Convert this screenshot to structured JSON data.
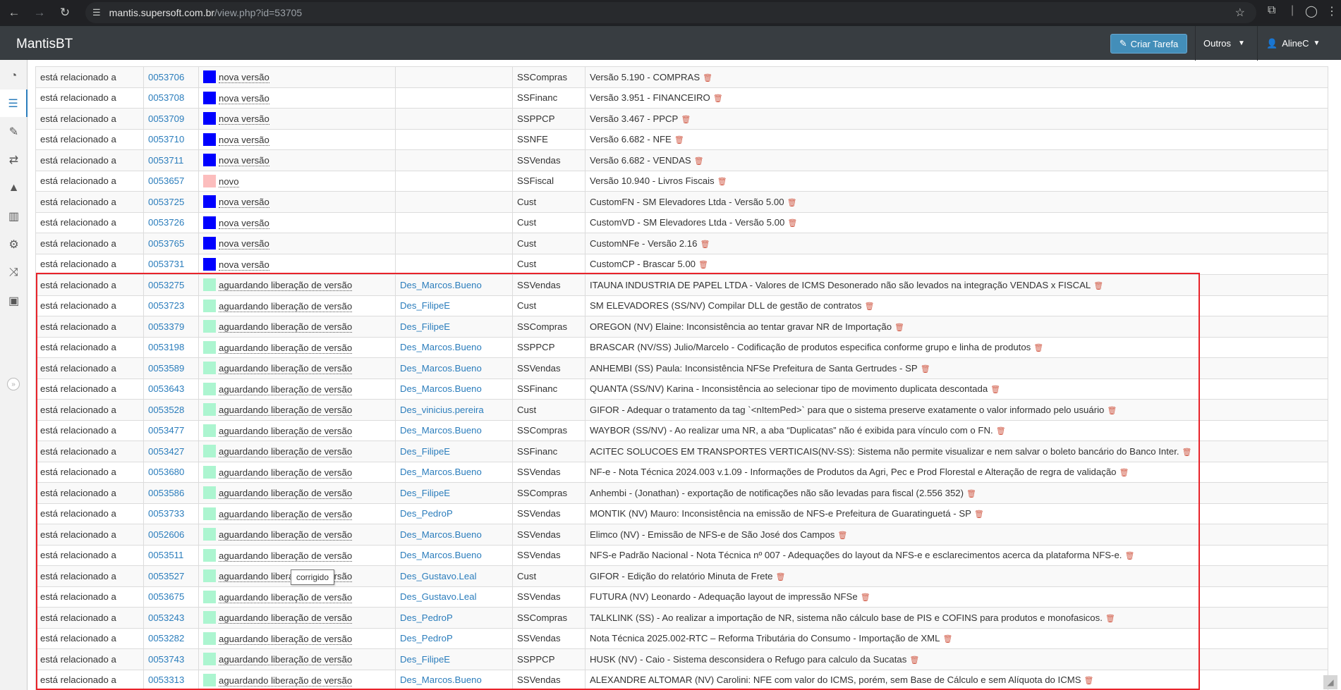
{
  "browser": {
    "url_host": "mantis.supersoft.com.br",
    "url_path": "/view.php?id=53705"
  },
  "app": {
    "brand": "MantisBT",
    "create_button": "Criar Tarefa",
    "others_menu": "Outros",
    "user": "AlineC"
  },
  "tooltip": "corrigido",
  "colors": {
    "nova_versao": "#0000ff",
    "novo": "#fcbdbd",
    "aguardando": "#acf5d0",
    "highlight": "#e8232a",
    "link": "#2b7dbc"
  },
  "rows": [
    {
      "rel": "está relacionado a",
      "id": "0053706",
      "status": "nova versão",
      "color": "#0000ff",
      "handler": "",
      "project": "SSCompras",
      "summary": "Versão 5.190 - COMPRAS"
    },
    {
      "rel": "está relacionado a",
      "id": "0053708",
      "status": "nova versão",
      "color": "#0000ff",
      "handler": "",
      "project": "SSFinanc",
      "summary": "Versão 3.951 - FINANCEIRO"
    },
    {
      "rel": "está relacionado a",
      "id": "0053709",
      "status": "nova versão",
      "color": "#0000ff",
      "handler": "",
      "project": "SSPPCP",
      "summary": "Versão 3.467 - PPCP"
    },
    {
      "rel": "está relacionado a",
      "id": "0053710",
      "status": "nova versão",
      "color": "#0000ff",
      "handler": "",
      "project": "SSNFE",
      "summary": "Versão 6.682 - NFE"
    },
    {
      "rel": "está relacionado a",
      "id": "0053711",
      "status": "nova versão",
      "color": "#0000ff",
      "handler": "",
      "project": "SSVendas",
      "summary": "Versão 6.682 - VENDAS"
    },
    {
      "rel": "está relacionado a",
      "id": "0053657",
      "status": "novo",
      "color": "#fcbdbd",
      "handler": "",
      "project": "SSFiscal",
      "summary": "Versão 10.940 - Livros Fiscais"
    },
    {
      "rel": "está relacionado a",
      "id": "0053725",
      "status": "nova versão",
      "color": "#0000ff",
      "handler": "",
      "project": "Cust",
      "summary": "CustomFN - SM Elevadores Ltda - Versão 5.00"
    },
    {
      "rel": "está relacionado a",
      "id": "0053726",
      "status": "nova versão",
      "color": "#0000ff",
      "handler": "",
      "project": "Cust",
      "summary": "CustomVD - SM Elevadores Ltda - Versão 5.00"
    },
    {
      "rel": "está relacionado a",
      "id": "0053765",
      "status": "nova versão",
      "color": "#0000ff",
      "handler": "",
      "project": "Cust",
      "summary": "CustomNFe - Versão 2.16"
    },
    {
      "rel": "está relacionado a",
      "id": "0053731",
      "status": "nova versão",
      "color": "#0000ff",
      "handler": "",
      "project": "Cust",
      "summary": "CustomCP - Brascar 5.00"
    },
    {
      "rel": "está relacionado a",
      "id": "0053275",
      "status": "aguardando liberação de versão",
      "color": "#acf5d0",
      "handler": "Des_Marcos.Bueno",
      "project": "SSVendas",
      "summary": "ITAUNA INDUSTRIA DE PAPEL LTDA - Valores de ICMS Desonerado não são levados na integração VENDAS x FISCAL"
    },
    {
      "rel": "está relacionado a",
      "id": "0053723",
      "status": "aguardando liberação de versão",
      "color": "#acf5d0",
      "handler": "Des_FilipeE",
      "project": "Cust",
      "summary": "SM ELEVADORES (SS/NV) Compilar DLL de gestão de contratos"
    },
    {
      "rel": "está relacionado a",
      "id": "0053379",
      "status": "aguardando liberação de versão",
      "color": "#acf5d0",
      "handler": "Des_FilipeE",
      "project": "SSCompras",
      "summary": "OREGON (NV) Elaine: Inconsistência ao tentar gravar NR de Importação"
    },
    {
      "rel": "está relacionado a",
      "id": "0053198",
      "status": "aguardando liberação de versão",
      "color": "#acf5d0",
      "handler": "Des_Marcos.Bueno",
      "project": "SSPPCP",
      "summary": "BRASCAR (NV/SS) Julio/Marcelo - Codificação de produtos especifica conforme grupo e linha de produtos"
    },
    {
      "rel": "está relacionado a",
      "id": "0053589",
      "status": "aguardando liberação de versão",
      "color": "#acf5d0",
      "handler": "Des_Marcos.Bueno",
      "project": "SSVendas",
      "summary": "ANHEMBI (SS) Paula: Inconsistência NFSe Prefeitura de Santa Gertrudes - SP"
    },
    {
      "rel": "está relacionado a",
      "id": "0053643",
      "status": "aguardando liberação de versão",
      "color": "#acf5d0",
      "handler": "Des_Marcos.Bueno",
      "project": "SSFinanc",
      "summary": "QUANTA (SS/NV) Karina - Inconsistência ao selecionar tipo de movimento duplicata descontada"
    },
    {
      "rel": "está relacionado a",
      "id": "0053528",
      "status": "aguardando liberação de versão",
      "color": "#acf5d0",
      "handler": "Des_vinicius.pereira",
      "project": "Cust",
      "summary": "GIFOR - Adequar o tratamento da tag `<nItemPed>` para que o sistema preserve exatamente o valor informado pelo usuário"
    },
    {
      "rel": "está relacionado a",
      "id": "0053477",
      "status": "aguardando liberação de versão",
      "color": "#acf5d0",
      "handler": "Des_Marcos.Bueno",
      "project": "SSCompras",
      "summary": "WAYBOR (SS/NV) - Ao realizar uma NR, a aba “Duplicatas” não é exibida para vínculo com o FN."
    },
    {
      "rel": "está relacionado a",
      "id": "0053427",
      "status": "aguardando liberação de versão",
      "color": "#acf5d0",
      "handler": "Des_FilipeE",
      "project": "SSFinanc",
      "summary": "ACITEC SOLUCOES EM TRANSPORTES VERTICAIS(NV-SS): Sistema não permite visualizar e nem salvar o boleto bancário do Banco Inter."
    },
    {
      "rel": "está relacionado a",
      "id": "0053680",
      "status": "aguardando liberação de versão",
      "color": "#acf5d0",
      "handler": "Des_Marcos.Bueno",
      "project": "SSVendas",
      "summary": "NF-e - Nota Técnica 2024.003 v.1.09 - Informações de Produtos da Agri, Pec e Prod Florestal e Alteração de regra de validação"
    },
    {
      "rel": "está relacionado a",
      "id": "0053586",
      "status": "aguardando liberação de versão",
      "color": "#acf5d0",
      "handler": "Des_FilipeE",
      "project": "SSCompras",
      "summary": "Anhembi - (Jonathan) - exportação de notificações não são levadas para fiscal (2.556 352)"
    },
    {
      "rel": "está relacionado a",
      "id": "0053733",
      "status": "aguardando liberação de versão",
      "color": "#acf5d0",
      "handler": "Des_PedroP",
      "project": "SSVendas",
      "summary": "MONTIK (NV) Mauro: Inconsistência na emissão de NFS-e Prefeitura de Guaratinguetá - SP"
    },
    {
      "rel": "está relacionado a",
      "id": "0052606",
      "status": "aguardando liberação de versão",
      "color": "#acf5d0",
      "handler": "Des_Marcos.Bueno",
      "project": "SSVendas",
      "summary": "Elimco (NV) - Emissão de NFS-e de São José dos Campos"
    },
    {
      "rel": "está relacionado a",
      "id": "0053511",
      "status": "aguardando liberação de versão",
      "color": "#acf5d0",
      "handler": "Des_Marcos.Bueno",
      "project": "SSVendas",
      "summary": "NFS-e Padrão Nacional - Nota Técnica nº 007 - Adequações do layout da NFS-e e esclarecimentos acerca da plataforma NFS-e."
    },
    {
      "rel": "está relacionado a",
      "id": "0053527",
      "status": "aguardando liberação de versão",
      "color": "#acf5d0",
      "handler": "Des_Gustavo.Leal",
      "project": "Cust",
      "summary": "GIFOR - Edição do relatório Minuta de Frete"
    },
    {
      "rel": "está relacionado a",
      "id": "0053675",
      "status": "aguardando liberação de versão",
      "color": "#acf5d0",
      "handler": "Des_Gustavo.Leal",
      "project": "SSVendas",
      "summary": "FUTURA (NV) Leonardo - Adequação layout de impressão NFSe"
    },
    {
      "rel": "está relacionado a",
      "id": "0053243",
      "status": "aguardando liberação de versão",
      "color": "#acf5d0",
      "handler": "Des_PedroP",
      "project": "SSCompras",
      "summary": "TALKLINK (SS) - Ao realizar a importação de NR, sistema não cálculo base de PIS e COFINS para produtos e monofasicos."
    },
    {
      "rel": "está relacionado a",
      "id": "0053282",
      "status": "aguardando liberação de versão",
      "color": "#acf5d0",
      "handler": "Des_PedroP",
      "project": "SSVendas",
      "summary": "Nota Técnica 2025.002-RTC – Reforma Tributária do Consumo - Importação de XML"
    },
    {
      "rel": "está relacionado a",
      "id": "0053743",
      "status": "aguardando liberação de versão",
      "color": "#acf5d0",
      "handler": "Des_FilipeE",
      "project": "SSPPCP",
      "summary": "HUSK (NV) - Caio - Sistema desconsidera o Refugo para calculo da Sucatas"
    },
    {
      "rel": "está relacionado a",
      "id": "0053313",
      "status": "aguardando liberação de versão",
      "color": "#acf5d0",
      "handler": "Des_Marcos.Bueno",
      "project": "SSVendas",
      "summary": "ALEXANDRE ALTOMAR (NV) Carolini: NFE com valor do ICMS, porém, sem Base de Cálculo e sem Alíquota do ICMS"
    }
  ]
}
